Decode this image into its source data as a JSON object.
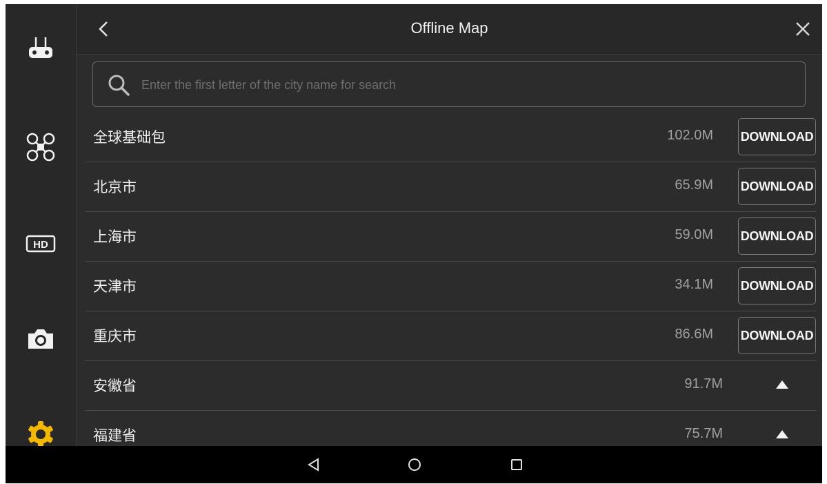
{
  "header": {
    "title": "Offline Map",
    "back_icon": "chevron-left-icon",
    "close_icon": "close-icon"
  },
  "search": {
    "placeholder": "Enter the first letter of the city name for search",
    "value": ""
  },
  "sidebar": {
    "items": [
      {
        "icon": "remote-controller-icon",
        "active": false
      },
      {
        "icon": "drone-icon",
        "active": false
      },
      {
        "icon": "hd-transmission-icon",
        "active": false
      },
      {
        "icon": "camera-icon",
        "active": false
      },
      {
        "icon": "gear-icon",
        "active": true
      }
    ],
    "active_color": "#f5b800"
  },
  "list": {
    "rows": [
      {
        "name": "全球基础包",
        "size": "102.0M",
        "action": "DOWNLOAD"
      },
      {
        "name": "北京市",
        "size": "65.9M",
        "action": "DOWNLOAD"
      },
      {
        "name": "上海市",
        "size": "59.0M",
        "action": "DOWNLOAD"
      },
      {
        "name": "天津市",
        "size": "34.1M",
        "action": "DOWNLOAD"
      },
      {
        "name": "重庆市",
        "size": "86.6M",
        "action": "DOWNLOAD"
      },
      {
        "name": "安徽省",
        "size": "91.7M",
        "action": "expand"
      },
      {
        "name": "福建省",
        "size": "75.7M",
        "action": "expand"
      }
    ]
  },
  "navbar": {
    "items": [
      "back-triangle-icon",
      "home-circle-icon",
      "recents-square-icon"
    ]
  }
}
